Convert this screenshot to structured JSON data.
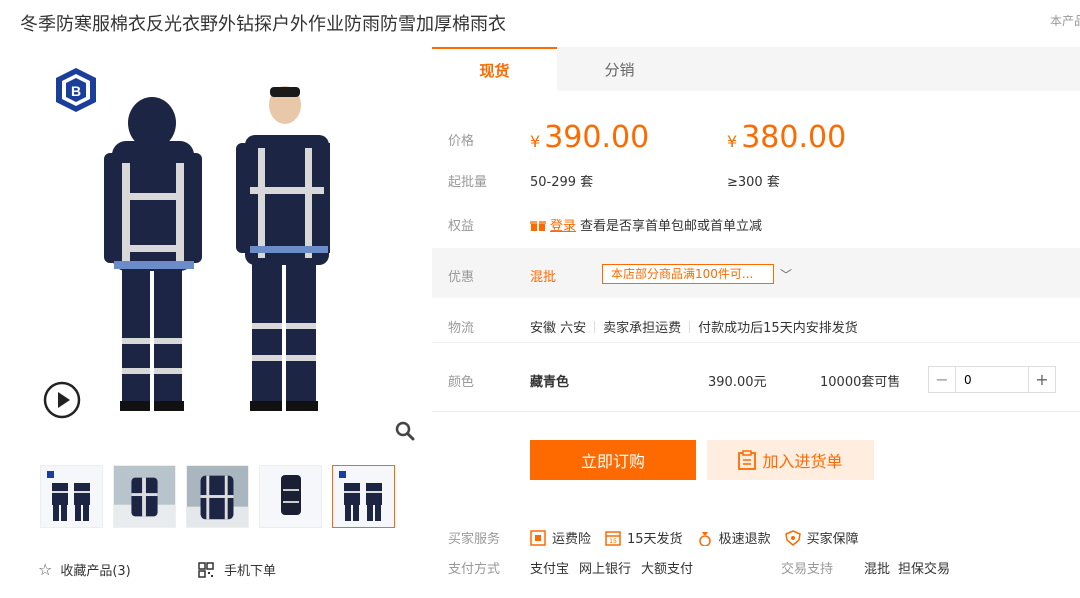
{
  "header": {
    "product_title": "冬季防寒服棉衣反光衣野外钻探户外作业防雨防雪加厚棉雨衣",
    "corner_text": "本产品"
  },
  "tabs": [
    {
      "label": "现货",
      "active": true
    },
    {
      "label": "分销",
      "active": false
    }
  ],
  "price": {
    "label": "价格",
    "currency": "¥",
    "tiers": [
      {
        "price": "390.00",
        "range": "50-299 套"
      },
      {
        "price": "380.00",
        "range": "≥300 套"
      }
    ],
    "min_qty_label": "起批量"
  },
  "rights": {
    "label": "权益",
    "login_text": "登录",
    "text": "查看是否享首单包邮或首单立减"
  },
  "promo": {
    "label": "优惠",
    "mixed": "混批",
    "tag": "本店部分商品满100件可...",
    "chevron": "﹀"
  },
  "logistics": {
    "label": "物流",
    "origin": "安徽 六安",
    "shipping": "卖家承担运费",
    "delivery": "付款成功后15天内安排发货"
  },
  "color": {
    "label": "颜色",
    "name": "藏青色",
    "price": "390.00元",
    "stock": "10000套可售",
    "quantity": "0"
  },
  "actions": {
    "buy": "立即订购",
    "cart": "加入进货单"
  },
  "services": {
    "label": "买家服务",
    "items": [
      "运费险",
      "15天发货",
      "极速退款",
      "买家保障"
    ]
  },
  "payment": {
    "label": "支付方式",
    "items": [
      "支付宝",
      "网上银行",
      "大额支付"
    ],
    "trade_label": "交易支持",
    "trade_items": [
      "混批",
      "担保交易"
    ]
  },
  "gallery": {
    "favorite": "收藏产品(3)",
    "mobile": "手机下单"
  },
  "colors": {
    "accent": "#ff6a00",
    "accent_light": "#ffede0",
    "navy": "#1c2544"
  }
}
